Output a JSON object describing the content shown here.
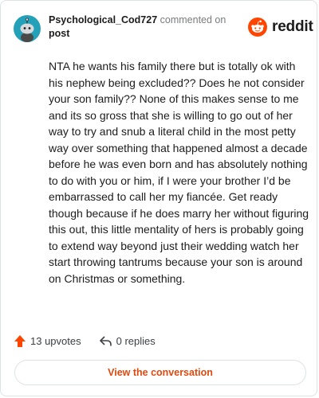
{
  "header": {
    "username": "Psychological_Cod727",
    "action_text": "commented on",
    "post_link": "post"
  },
  "brand": {
    "name": "reddit"
  },
  "comment": {
    "text": "NTA he wants his family there but is totally ok with his nephew being excluded?? Does he not consider your son family?? None of this makes sense to me and its so gross that she is willing to go out of her way to try and snub a literal child in the most petty way over something that happened almost a decade before he was even born and has absolutely nothing to do with you or him, if I were your brother I’d be embarrassed to call her my fiancée. Get ready though because if he does marry her without figuring this out, this little mentality of hers is probably going to extend way beyond just their wedding watch her start throwing tantrums because your son is around on Christmas or something."
  },
  "stats": {
    "upvotes": "13 upvotes",
    "replies": "0 replies"
  },
  "cta": {
    "label": "View the conversation"
  },
  "colors": {
    "accent": "#ff4500",
    "avatar_bg": "#24a0b8",
    "link_text": "#e0490f"
  },
  "icons": [
    "snoo-avatar-icon",
    "reddit-logo-icon",
    "upvote-arrow-icon",
    "reply-arrow-icon"
  ]
}
